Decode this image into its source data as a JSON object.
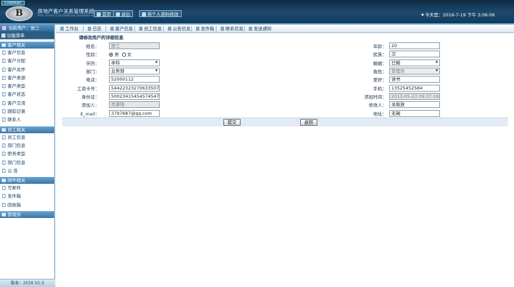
{
  "header": {
    "logo_tag": "COMPANY",
    "logo_letter": "B",
    "app_title": "房地产客户关系管理系统",
    "app_subtitle": "REAL ESTATE CUSTOMER RELATIONSHIP MANAGEMENT SYSTEM",
    "buttons": [
      "首页",
      "退出",
      "将个人资料修改"
    ],
    "datetime": "今天是：2016-7-19 下午 3:06:06"
  },
  "sidebar": {
    "user": "当前用户：张三",
    "active": "功能菜单",
    "groups": [
      {
        "title": "客户相关",
        "items": [
          "客户信息",
          "客户分配",
          "客户关怀",
          "客户来源",
          "客户类型",
          "客户状态",
          "客户交流",
          "跟踪记录",
          "联系人"
        ]
      },
      {
        "title": "员工相关",
        "items": [
          "员工信息",
          "部门信息",
          "职务类型",
          "部门信息",
          "公 告"
        ]
      },
      {
        "title": "邮件相关",
        "items": [
          "写邮件",
          "发件箱",
          "回收箱"
        ]
      },
      {
        "title": "管理员",
        "items": []
      }
    ],
    "version": "版本：2016 V1.0"
  },
  "nav": {
    "tabs": [
      "工作台",
      "日志",
      "客户信息",
      "员工信息",
      "公告信息",
      "发件箱",
      "联系信息",
      "发送通知"
    ]
  },
  "form": {
    "title": "请修改用户的详细信息",
    "rows": [
      {
        "l1": "姓名：",
        "v1": "张三",
        "t1": "input-disabled",
        "l2": "年龄：",
        "v2": "20",
        "t2": "input"
      },
      {
        "l1": "性别：",
        "v1": "",
        "t1": "radio",
        "opts": [
          "男",
          "女"
        ],
        "selected": 0,
        "l2": "民族：",
        "v2": "汉",
        "t2": "input"
      },
      {
        "l1": "学历：",
        "v1": "本科",
        "t1": "select",
        "l2": "婚姻：",
        "v2": "已婚",
        "t2": "select"
      },
      {
        "l1": "部门：",
        "v1": "业务部",
        "t1": "select",
        "l2": "角色：",
        "v2": "管理员",
        "t2": "select-disabled"
      },
      {
        "l1": "电话：",
        "v1": "52000112",
        "t1": "input",
        "l2": "爱好：",
        "v2": "读书",
        "t2": "input"
      },
      {
        "l1": "工资卡号：",
        "v1": "544223232706335070",
        "t1": "input",
        "l2": "手机：",
        "v2": "13525452584",
        "t2": "input"
      },
      {
        "l1": "身份证：",
        "v1": "500234154545745474",
        "t1": "input",
        "l2": "添加时间：",
        "v2": "2013-05-23 09:37:18.0",
        "t2": "input-disabled"
      },
      {
        "l1": "添加人：",
        "v1": "肖景阳",
        "t1": "input-disabled",
        "l2": "修改人：",
        "v2": "关极放",
        "t2": "input"
      },
      {
        "l1": "E_mail：",
        "v1": "3797687@qq.com",
        "t1": "input",
        "l2": "地址：",
        "v2": "无锡",
        "t2": "input"
      }
    ],
    "submit_label": "提交",
    "back_label": "返回"
  },
  "colors": {
    "header_bg": "#1e4a6e",
    "accent": "#3a77a8",
    "form_bar": "#e2ebf4"
  }
}
